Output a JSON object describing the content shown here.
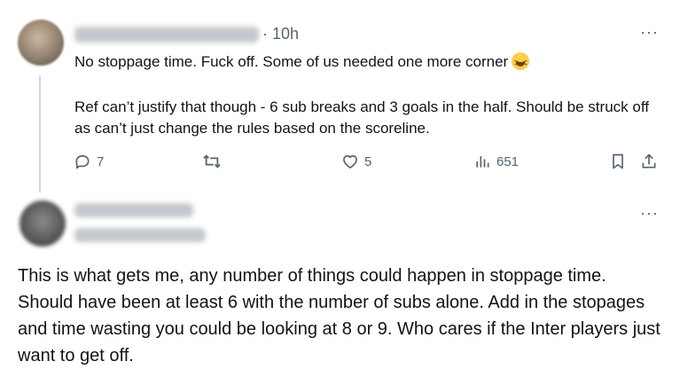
{
  "tweet1": {
    "time": "· 10h",
    "line1": "No stoppage time. Fuck off. Some of us needed one more corner",
    "line2": "Ref can’t justify that though - 6 sub breaks and 3 goals in the half. Should be struck off as can’t just change the rules based on the scoreline.",
    "emoji": "grinning-squinting-face-emoji",
    "replies": "7",
    "likes": "5",
    "views": "651"
  },
  "tweet2": {
    "text": "This is what gets me, any number of things could happen in stoppage time. Should have been at least 6 with the number of subs alone. Add in the stopages and time wasting you could be looking at 8 or 9. Who cares if the Inter players just want to get off."
  },
  "colors": {
    "text": "#0f1419",
    "secondary": "#536471",
    "thread_line": "#cfd9de"
  }
}
